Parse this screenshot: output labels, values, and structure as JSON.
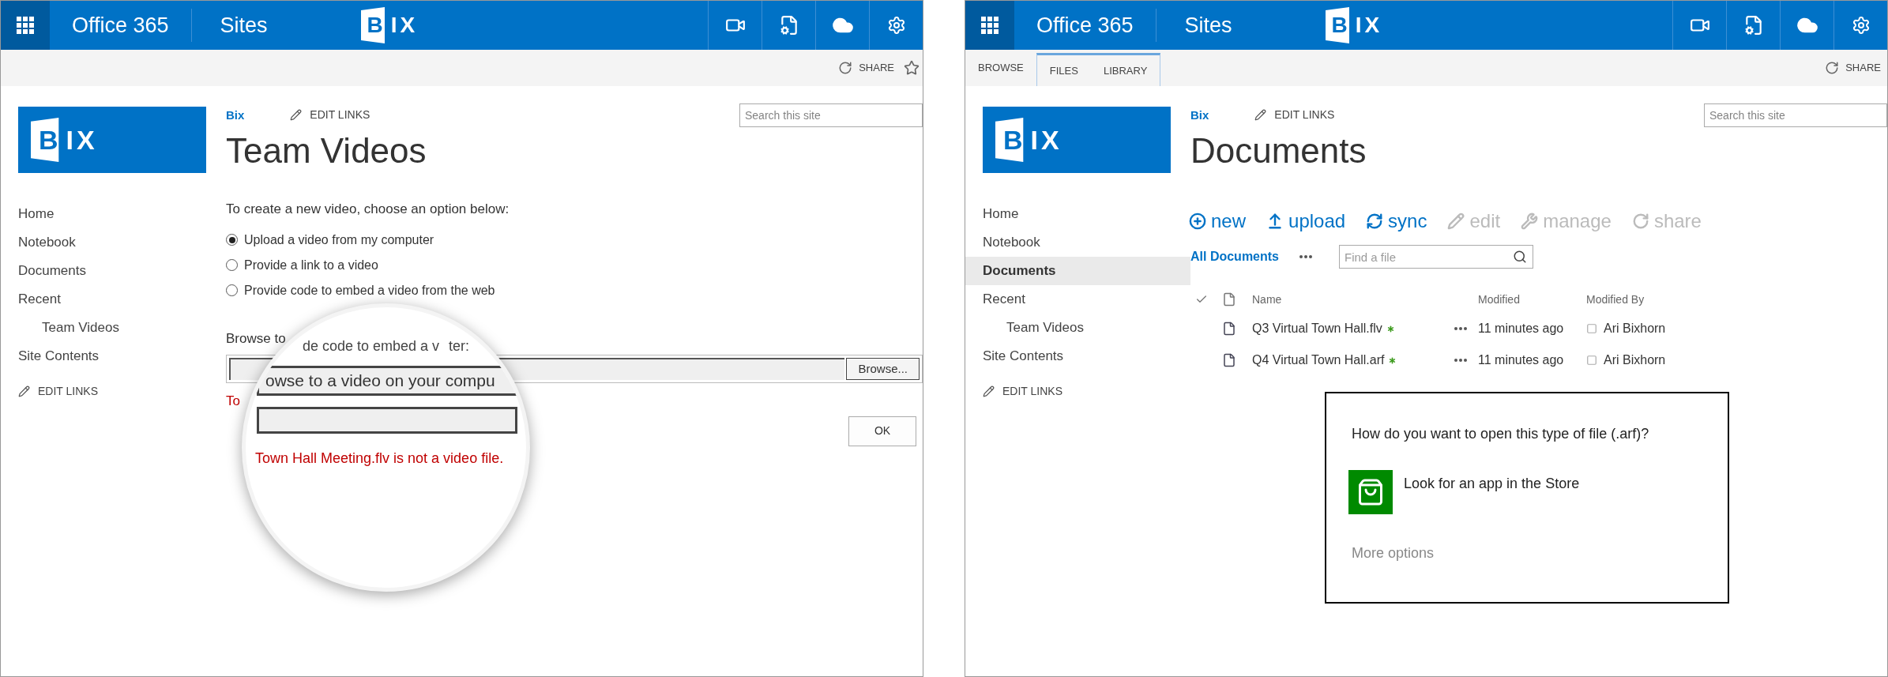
{
  "panels": [
    {
      "kind": "new_video",
      "suite_bar": {
        "app_name": "Office 365",
        "section": "Sites",
        "logo": "BIX"
      },
      "ribbon": {
        "actions": [
          {
            "kind": "share",
            "label": "SHARE"
          },
          {
            "kind": "follow"
          }
        ]
      },
      "site_logo": "BIX",
      "breadcrumb": "Bix",
      "edit_links": "EDIT LINKS",
      "search": {
        "placeholder": "Search this site"
      },
      "title": "Team Videos",
      "nav": [
        {
          "label": "Home",
          "selected": false
        },
        {
          "label": "Notebook",
          "selected": false
        },
        {
          "label": "Documents",
          "selected": false
        },
        {
          "label": "Recent",
          "selected": false,
          "children": [
            {
              "label": "Team Videos",
              "selected": false
            }
          ]
        },
        {
          "label": "Site Contents",
          "selected": false
        }
      ],
      "nav_edit_links": "EDIT LINKS",
      "form": {
        "intro": "To create a new video, choose an option below:",
        "options": [
          {
            "label": "Upload a video from my computer",
            "selected": true
          },
          {
            "label": "Provide a link to a video",
            "selected": false
          },
          {
            "label": "Provide code to embed a video from the web",
            "selected": false
          }
        ],
        "browse_label": "Browse to",
        "browse_button": "Browse...",
        "error_fragment": "To",
        "ok_button": "OK",
        "magnifier": {
          "label_fragment": "de code to embed a v",
          "label_tail": "ter:",
          "field_text": "owse to a video on your compu",
          "error": "Town Hall Meeting.flv is not a video file."
        }
      }
    },
    {
      "kind": "library",
      "suite_bar": {
        "app_name": "Office 365",
        "section": "Sites",
        "logo": "BIX"
      },
      "ribbon": {
        "tabs": [
          {
            "label": "BROWSE",
            "selected": false
          }
        ],
        "tab_group": [
          {
            "label": "FILES",
            "selected": false
          },
          {
            "label": "LIBRARY",
            "selected": false
          }
        ],
        "actions": [
          {
            "kind": "share",
            "label": "SHARE"
          }
        ]
      },
      "site_logo": "BIX",
      "breadcrumb": "Bix",
      "edit_links": "EDIT LINKS",
      "search": {
        "placeholder": "Search this site"
      },
      "title": "Documents",
      "nav": [
        {
          "label": "Home",
          "selected": false
        },
        {
          "label": "Notebook",
          "selected": false
        },
        {
          "label": "Documents",
          "selected": true
        },
        {
          "label": "Recent",
          "selected": false,
          "children": [
            {
              "label": "Team Videos",
              "selected": false
            }
          ]
        },
        {
          "label": "Site Contents",
          "selected": false
        }
      ],
      "nav_edit_links": "EDIT LINKS",
      "library": {
        "commands": [
          {
            "kind": "new",
            "label": "new",
            "disabled": false
          },
          {
            "kind": "upload",
            "label": "upload",
            "disabled": false
          },
          {
            "kind": "sync",
            "label": "sync",
            "disabled": false
          },
          {
            "kind": "edit",
            "label": "edit",
            "disabled": true
          },
          {
            "kind": "manage",
            "label": "manage",
            "disabled": true
          },
          {
            "kind": "share",
            "label": "share",
            "disabled": true
          }
        ],
        "view": "All Documents",
        "find": {
          "placeholder": "Find a file"
        },
        "columns": [
          "Name",
          "Modified",
          "Modified By"
        ],
        "rows": [
          {
            "name": "Q3 Virtual Town Hall.flv",
            "new": true,
            "modified": "11 minutes ago",
            "modified_by": "Ari Bixhorn"
          },
          {
            "name": "Q4 Virtual Town Hall.arf",
            "new": true,
            "modified": "11 minutes ago",
            "modified_by": "Ari Bixhorn"
          }
        ],
        "dialog": {
          "question": "How do you want to open this type of file (.arf)?",
          "store_option": "Look for an app in the Store",
          "more_options": "More options"
        }
      }
    }
  ]
}
